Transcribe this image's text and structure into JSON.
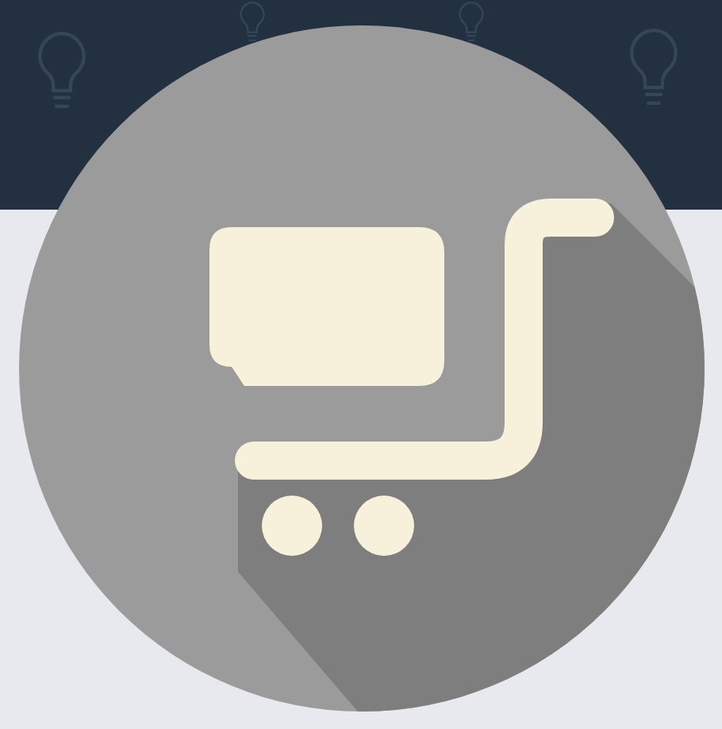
{
  "header": {
    "kind": "pattern"
  },
  "badge": {
    "kind": "cart"
  }
}
